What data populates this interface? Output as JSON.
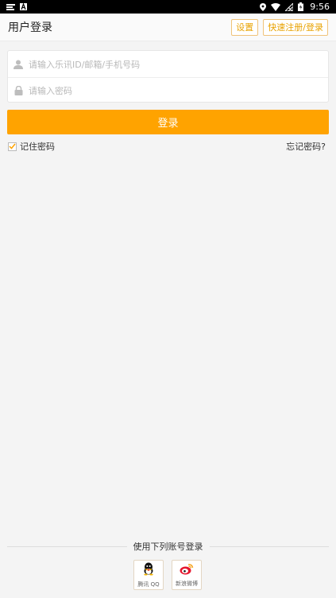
{
  "status_bar": {
    "time": "9:56",
    "icons": [
      "notification-icon",
      "text-icon",
      "location-icon",
      "wifi-icon",
      "no-signal-icon",
      "battery-icon"
    ]
  },
  "header": {
    "title": "用户登录",
    "settings_label": "设置",
    "register_label": "快速注册/登录"
  },
  "form": {
    "account_placeholder": "请输入乐讯ID/邮箱/手机号码",
    "password_placeholder": "请输入密码",
    "login_label": "登录",
    "remember_label": "记住密码",
    "remember_checked": true,
    "forgot_label": "忘记密码?"
  },
  "third_party": {
    "title": "使用下列账号登录",
    "providers": [
      {
        "label": "腾讯 QQ",
        "icon": "qq-icon"
      },
      {
        "label": "新浪微博",
        "icon": "weibo-icon"
      }
    ]
  },
  "colors": {
    "accent": "#ffa300",
    "chip_border": "#f0c37a",
    "chip_text": "#e8a200",
    "background": "#f4f4f4"
  }
}
